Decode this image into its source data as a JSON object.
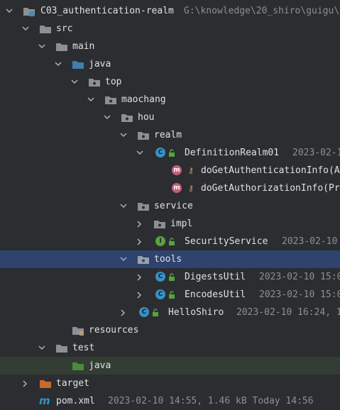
{
  "project": {
    "name": "C03_authentication-realm",
    "path": "G:\\knowledge\\20_shiro\\guigu\\"
  },
  "tree": {
    "src": "src",
    "main": "main",
    "java": "java",
    "top": "top",
    "maochang": "maochang",
    "hou": "hou",
    "realm": "realm",
    "definition_realm": {
      "name": "DefinitionRealm01",
      "meta": "2023-02-1"
    },
    "method1": "doGetAuthenticationInfo(A",
    "method2": "doGetAuthorizationInfo(Pr",
    "service": "service",
    "impl": "impl",
    "security_service": {
      "name": "SecurityService",
      "meta": "2023-02-10"
    },
    "tools": "tools",
    "digests_util": {
      "name": "DigestsUtil",
      "meta": "2023-02-10 15:0"
    },
    "encodes_util": {
      "name": "EncodesUtil",
      "meta": "2023-02-10 15:0"
    },
    "hello_shiro": {
      "name": "HelloShiro",
      "meta": "2023-02-10 16:24, 1"
    },
    "resources": "resources",
    "test": "test",
    "test_java": "java",
    "target": "target",
    "pom": {
      "name": "pom.xml",
      "meta": "2023-02-10 14:55, 1.46 kB Today 14:56"
    }
  },
  "icons": {
    "class_letter": "C",
    "interface_letter": "I",
    "method_letter": "m",
    "key_glyph": "⚷"
  },
  "colors": {
    "background": "#2b2d30",
    "selection": "#2e436e",
    "folder_gray": "#8c8f94",
    "folder_source_blue": "#3d7fb0",
    "folder_test_green": "#4e8a3a",
    "folder_excluded_orange": "#c9692c",
    "class_blue": "#3592c4",
    "interface_green": "#5aa13f",
    "method_pink": "#c75c7b"
  }
}
